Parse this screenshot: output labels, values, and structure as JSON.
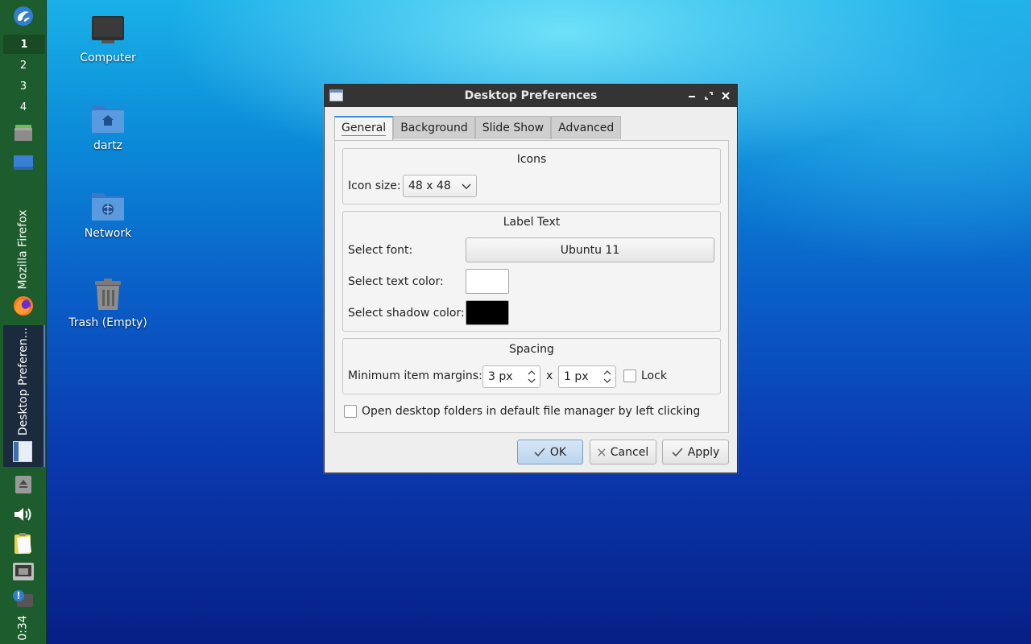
{
  "panel": {
    "workspaces": [
      "1",
      "2",
      "3",
      "4"
    ],
    "active_workspace": "1",
    "tasks": {
      "firefox": "Mozilla Firefox",
      "desktop_prefs": "Desktop Preferen..."
    },
    "clock": "0:34"
  },
  "desktop": {
    "icons": [
      {
        "label": "Computer",
        "icon": "computer-icon"
      },
      {
        "label": "dartz",
        "icon": "home-folder-icon"
      },
      {
        "label": "Network",
        "icon": "network-folder-icon"
      },
      {
        "label": "Trash (Empty)",
        "icon": "trash-icon"
      }
    ]
  },
  "dialog": {
    "title": "Desktop Preferences",
    "tabs": [
      "General",
      "Background",
      "Slide Show",
      "Advanced"
    ],
    "active_tab": "General",
    "icons_group": {
      "title": "Icons",
      "icon_size_label": "Icon size:",
      "icon_size_value": "48 x 48"
    },
    "label_text_group": {
      "title": "Label Text",
      "font_label": "Select font:",
      "font_value": "Ubuntu 11",
      "text_color_label": "Select text color:",
      "text_color": "#ffffff",
      "shadow_color_label": "Select shadow color:",
      "shadow_color": "#000000"
    },
    "spacing_group": {
      "title": "Spacing",
      "margins_label": "Minimum item margins:",
      "margin_x": "3 px",
      "separator": "x",
      "margin_y": "1 px",
      "lock_label": "Lock",
      "lock_checked": false
    },
    "open_folders_label": "Open desktop folders in default file manager by left clicking",
    "open_folders_checked": false,
    "buttons": {
      "ok": "OK",
      "cancel": "Cancel",
      "apply": "Apply"
    }
  },
  "colors": {
    "panel_bg": "#1d5c2c",
    "titlebar_bg": "#343434",
    "accent": "#3b8fd6"
  }
}
